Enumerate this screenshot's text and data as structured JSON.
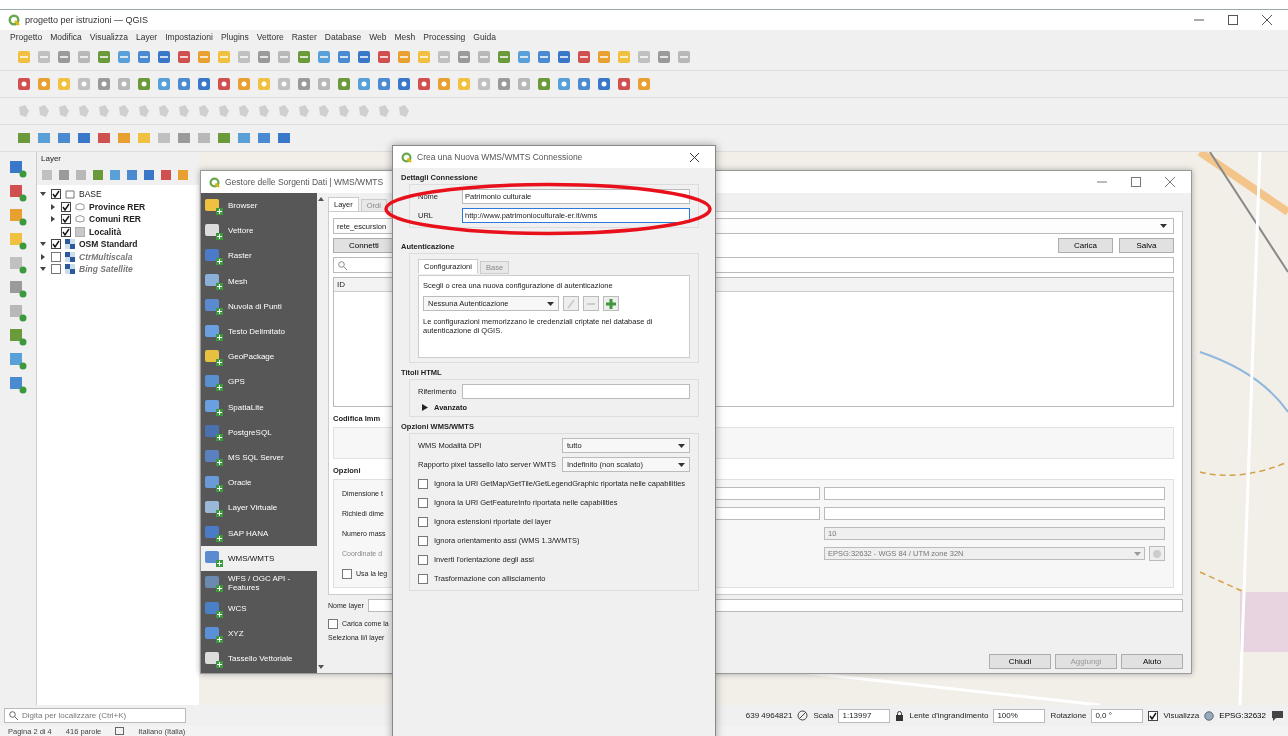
{
  "window": {
    "title": "progetto per istruzioni — QGIS"
  },
  "menu": [
    "Progetto",
    "Modifica",
    "Visualizza",
    "Layer",
    "Impostazioni",
    "Plugins",
    "Vettore",
    "Raster",
    "Database",
    "Web",
    "Mesh",
    "Processing",
    "Guida"
  ],
  "layers_panel": {
    "title": "Layer",
    "items": [
      {
        "label": "BASE",
        "kind": "group",
        "checked": true,
        "expanded": true,
        "children": [
          {
            "label": "Province RER",
            "kind": "polygon",
            "checked": true,
            "expanded": false
          },
          {
            "label": "Comuni RER",
            "kind": "polygon",
            "checked": true,
            "expanded": false
          },
          {
            "label": "Località",
            "kind": "point",
            "checked": true
          }
        ]
      },
      {
        "label": "OSM Standard",
        "kind": "raster",
        "checked": true,
        "expanded": true
      },
      {
        "label": "CtrMultiscala",
        "kind": "raster",
        "checked": false,
        "expanded": false
      },
      {
        "label": "Bing Satellite",
        "kind": "raster",
        "checked": false,
        "expanded": true
      }
    ]
  },
  "data_source_manager": {
    "title": "Gestore delle Sorgenti Dati | WMS/WMTS",
    "sources": [
      {
        "label": "Browser",
        "selected": false
      },
      {
        "label": "Vettore",
        "selected": false
      },
      {
        "label": "Raster",
        "selected": false
      },
      {
        "label": "Mesh",
        "selected": false
      },
      {
        "label": "Nuvola di Punti",
        "selected": false
      },
      {
        "label": "Testo Delimitato",
        "selected": false
      },
      {
        "label": "GeoPackage",
        "selected": false
      },
      {
        "label": "GPS",
        "selected": false
      },
      {
        "label": "SpatiaLite",
        "selected": false
      },
      {
        "label": "PostgreSQL",
        "selected": false
      },
      {
        "label": "MS SQL Server",
        "selected": false
      },
      {
        "label": "Oracle",
        "selected": false
      },
      {
        "label": "Layer Virtuale",
        "selected": false
      },
      {
        "label": "SAP HANA",
        "selected": false
      },
      {
        "label": "WMS/WMTS",
        "selected": true
      },
      {
        "label": "WFS / OGC API - Features",
        "selected": false
      },
      {
        "label": "WCS",
        "selected": false
      },
      {
        "label": "XYZ",
        "selected": false
      },
      {
        "label": "Tassello Vettoriale",
        "selected": false
      }
    ],
    "tabs": [
      {
        "label": "Layer",
        "selected": true
      },
      {
        "label": "Ordi",
        "selected": false
      }
    ],
    "connection": "rete_escursion",
    "connect_button": "Connetti",
    "load_button": "Carica",
    "save_button": "Salva",
    "table_columns": [
      "ID"
    ],
    "encoding_title": "Codifica Imm",
    "options_title": "Opzioni",
    "options": [
      {
        "kind": "pair",
        "label": "Dimensione t"
      },
      {
        "kind": "pair",
        "label": "Richiedi dime"
      },
      {
        "kind": "number",
        "label": "Numero mass",
        "value": "10",
        "disabled": true
      },
      {
        "kind": "crs",
        "label": "Coordinate d",
        "value": "EPSG:32632 - WGS 84 / UTM zone 32N",
        "disabled": true
      },
      {
        "kind": "checkbox",
        "label": "Usa la leg",
        "checked": false
      }
    ],
    "layer_name_label": "Nome layer",
    "load_as_group": {
      "label": "Carica come la",
      "checked": false
    },
    "hint": "Seleziona il/i layer",
    "buttons": [
      {
        "label": "Chiudi",
        "disabled": false
      },
      {
        "label": "Aggiungi",
        "disabled": true
      },
      {
        "label": "Aiuto",
        "disabled": false
      }
    ]
  },
  "new_connection_dialog": {
    "title": "Crea una Nuova WMS/WMTS Connessione",
    "details_title": "Dettagli Connessione",
    "fields": [
      {
        "label": "Nome",
        "value": "Patrimonio culturale",
        "focused": false
      },
      {
        "label": "URL",
        "value": "http://www.patrimonioculturale-er.it/wms",
        "focused": true
      }
    ],
    "auth_title": "Autenticazione",
    "auth_tabs": [
      {
        "label": "Configurazioni",
        "selected": true
      },
      {
        "label": "Base",
        "selected": false
      }
    ],
    "auth_prompt": "Scegli o crea una nuova configurazione di autenticazione",
    "auth_config": "Nessuna Autenticazione",
    "auth_note": "Le configurazioni memorizzano le credenziali criptate nel database di autenticazione di QGIS.",
    "headers_title": "Titoli HTML",
    "referer_label": "Riferimento",
    "advanced": {
      "label": "Avanzato",
      "expanded": false
    },
    "wms_title": "Opzioni WMS/WMTS",
    "selects": [
      {
        "label": "WMS Modalità DPI",
        "value": "tutto"
      },
      {
        "label": "Rapporto pixel tassello lato server WMTS",
        "value": "Indefinito (non scalato)"
      }
    ],
    "checks": [
      {
        "label": "Ignora la URI GetMap/GetTile/GetLegendGraphic riportata nelle capabilities",
        "checked": false
      },
      {
        "label": "Ignora la URI GetFeatureInfo riportata nelle capabilities",
        "checked": false
      },
      {
        "label": "Ignora estensioni riportate del layer",
        "checked": false
      },
      {
        "label": "Ignora orientamento assi (WMS 1.3/WMTS)",
        "checked": false
      },
      {
        "label": "Inverti l'orientazione degli assi",
        "checked": false
      },
      {
        "label": "Trasformazione con allisciamento",
        "checked": false
      }
    ]
  },
  "status_bar": {
    "locator_placeholder": "Digita per localizzare (Ctrl+K)",
    "coordinate": "639  4964821",
    "scale_label": "Scala",
    "scale": "1:13997",
    "magnifier_label": "Lente d'ingrandimento",
    "magnifier": "100%",
    "rotation_label": "Rotazione",
    "rotation": "0,0 °",
    "render": {
      "label": "Visualizza",
      "checked": true
    },
    "crs": "EPSG:32632"
  },
  "document_status": {
    "page": "Pagina 2 di 4",
    "words": "416 parole",
    "language": "Italiano (Italia)"
  }
}
